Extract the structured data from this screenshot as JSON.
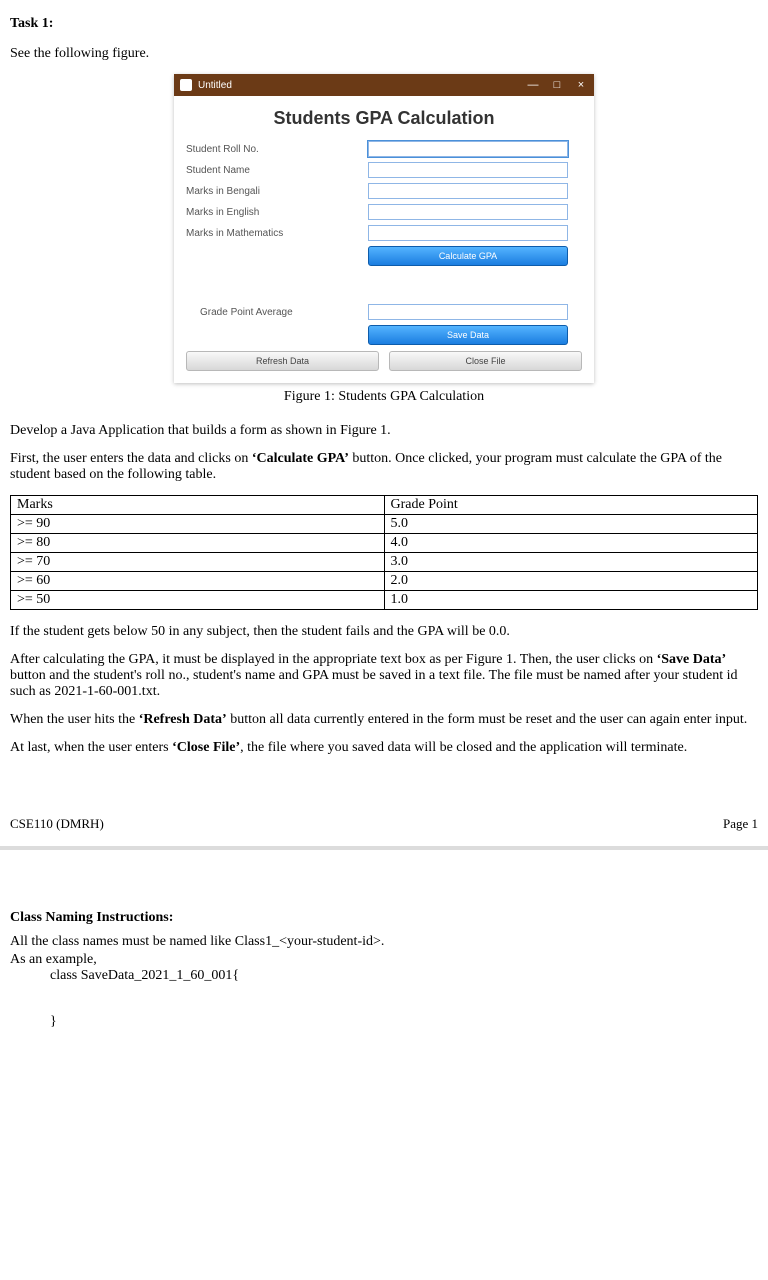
{
  "task_heading": "Task 1:",
  "intro": "See the following figure.",
  "window": {
    "title": "Untitled",
    "minimize": "—",
    "maximize": "□",
    "close": "×",
    "app_title": "Students GPA Calculation",
    "labels": {
      "roll": "Student Roll No.",
      "name": "Student Name",
      "bengali": "Marks in Bengali",
      "english": "Marks in English",
      "math": "Marks in Mathematics",
      "gpa": "Grade Point Average"
    },
    "buttons": {
      "calc": "Calculate GPA",
      "save": "Save Data",
      "refresh": "Refresh Data",
      "closefile": "Close File"
    }
  },
  "fig_caption": "Figure 1: Students GPA Calculation",
  "para1": "Develop a Java Application that builds a form as shown in Figure 1.",
  "para2a": "First, the user enters the data and clicks on ",
  "para2b": "‘Calculate GPA’",
  "para2c": " button. Once clicked, your program must calculate the GPA of the student based on the following table.",
  "grade_table": {
    "head_marks": "Marks",
    "head_gp": "Grade Point",
    "rows": [
      {
        "m": ">= 90",
        "g": "5.0"
      },
      {
        "m": ">= 80",
        "g": "4.0"
      },
      {
        "m": ">= 70",
        "g": "3.0"
      },
      {
        "m": ">= 60",
        "g": "2.0"
      },
      {
        "m": ">= 50",
        "g": "1.0"
      }
    ]
  },
  "para3": "If the student gets below 50 in any subject, then the student fails and the GPA will be 0.0.",
  "para4a": "After calculating the GPA, it must be displayed in the appropriate text box as per Figure 1. Then, the user clicks on ",
  "para4b": "‘Save Data’",
  "para4c": " button and the student's roll no., student's name and GPA must be saved in a text file. The file must be named after your student id such as 2021-1-60-001.txt.",
  "para5a": "When the user hits the ",
  "para5b": "‘Refresh Data’",
  "para5c": " button all data currently entered in the form must be reset and the user can again enter input.",
  "para6a": "At last, when the user enters ",
  "para6b": "‘Close File’",
  "para6c": ", the file where you saved data will be closed and the application will terminate.",
  "footer_left": "CSE110 (DMRH)",
  "footer_right": "Page 1",
  "section2_heading": "Class Naming Instructions:",
  "section2_p1": "All the class names must be named like Class1_<your-student-id>.",
  "section2_p2": "As an example,",
  "section2_code": "class SaveData_2021_1_60_001{",
  "section2_brace": "}"
}
